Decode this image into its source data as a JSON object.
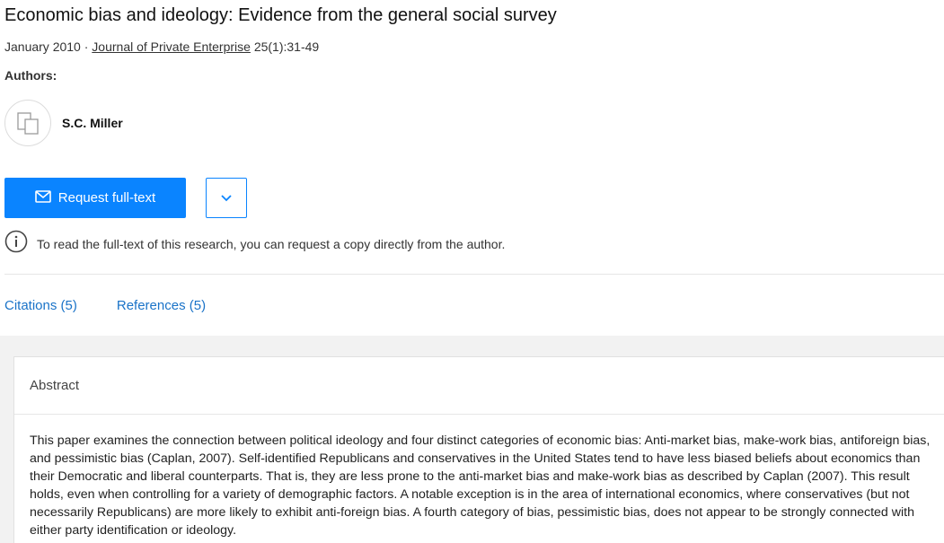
{
  "paper": {
    "title": "Economic bias and ideology: Evidence from the general social survey",
    "date_prefix": "January 2010 · ",
    "journal": "Journal of Private Enterprise",
    "citation": " 25(1):31-49"
  },
  "authors": {
    "label": "Authors:",
    "items": [
      {
        "name": "S.C. Miller",
        "icon": "placeholder-avatar-icon"
      }
    ]
  },
  "actions": {
    "request_label": "Request full-text",
    "request_icon": "mail-icon",
    "more_icon": "chevron-down-icon"
  },
  "info": {
    "icon": "info-icon",
    "text": "To read the full-text of this research, you can request a copy directly from the author."
  },
  "tabs": [
    {
      "label": "Citations (5)"
    },
    {
      "label": "References (5)"
    }
  ],
  "abstract": {
    "heading": "Abstract",
    "text": "This paper examines the connection between political ideology and four distinct categories of economic bias: Anti-market bias, make-work bias, antiforeign bias, and pessimistic bias (Caplan, 2007). Self-identified Republicans and conservatives in the United States tend to have less biased beliefs about economics than their Democratic and liberal counterparts. That is, they are less prone to the anti-market bias and make-work bias as described by Caplan (2007). This result holds, even when controlling for a variety of demographic factors. A notable exception is in the area of international economics, where conservatives (but not necessarily Republicans) are more likely to exhibit anti-foreign bias. A fourth category of bias, pessimistic bias, does not appear to be strongly connected with either party identification or ideology."
  },
  "colors": {
    "accent": "#0a84ff",
    "link": "#1a73c8",
    "background_alt": "#f2f2f2"
  }
}
